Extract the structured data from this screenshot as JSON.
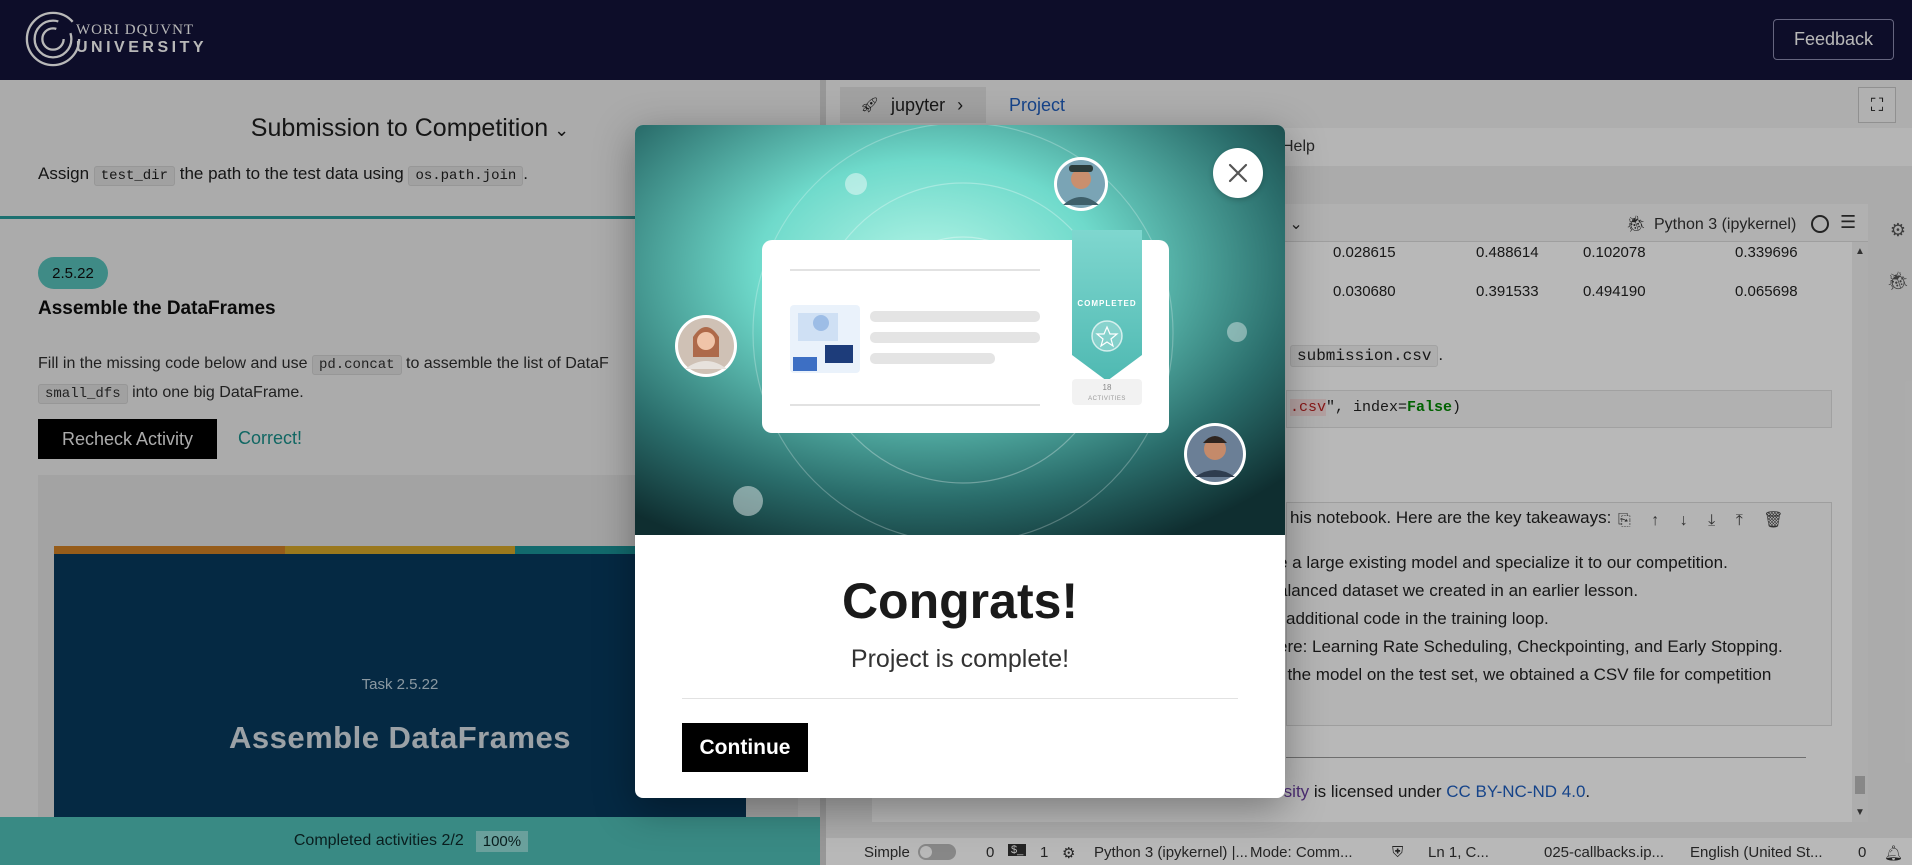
{
  "header": {
    "logo_line1": "WORI DQUVNT",
    "logo_line2": "UNIVERSITY",
    "feedback_label": "Feedback"
  },
  "left_panel": {
    "title": "Submission to Competition",
    "clipped_text_prefix": "Assign",
    "clipped_code_1": "test_dir",
    "clipped_text_mid": "the path to the test data using",
    "clipped_code_2": "os.path.join",
    "clipped_text_suffix": ".",
    "badge": "2.5.22",
    "heading": "Assemble the DataFrames",
    "para_prefix": "Fill in the missing code below and use",
    "para_code_1": "pd.concat",
    "para_mid": "to assemble the list of DataF",
    "para_code_2": "small_dfs",
    "para_suffix": "into one big DataFrame.",
    "recheck_label": "Recheck Activity",
    "correct_label": "Correct!",
    "task_subtitle": "Task 2.5.22",
    "task_title": "Assemble DataFrames",
    "progress_label": "Completed activities 2/2",
    "progress_pct": "100%",
    "progress_value": 1.0
  },
  "jupyter": {
    "tab_label": "jupyter",
    "project_label": "Project",
    "menu_help": "Help",
    "kernel_select_fragment": "n",
    "kernel_name": "Python 3 (ipykernel)",
    "df_rows": [
      [
        "0.028615",
        "0.488614",
        "0.102078",
        "0.339696"
      ],
      [
        "0.030680",
        "0.391533",
        "0.494190",
        "0.065698"
      ]
    ],
    "submission_text": "submission.csv",
    "submission_suffix": ".",
    "code_str_part": ".csv",
    "code_rest": "\", index=",
    "code_false": "False",
    "code_close": ")",
    "takeaways_intro": "his notebook. Here are the key takeaways:",
    "takeaways": [
      "e a large existing model and specialize it to our competition.",
      "alanced dataset we created in an earlier lesson.",
      "additional code in the training loop.",
      "ere: Learning Rate Scheduling, Checkpointing, and Early Stopping.",
      "f the model on the test set, we obtained a CSV file for competition"
    ],
    "license_prefix": "rsity",
    "license_mid": "is licensed under",
    "license_link": "CC BY-NC-ND 4.0",
    "license_suffix": "."
  },
  "statusbar": {
    "mode_simple": "Simple",
    "count_0": "0",
    "count_1": "1",
    "kernel": "Python 3 (ipykernel) |...",
    "mode": "Mode: Comm...",
    "position": "Ln 1, C...",
    "filename": "025-callbacks.ip...",
    "language": "English (United St...",
    "notifications": "0"
  },
  "modal": {
    "card_badge": "COMPLETED",
    "card_activities_count": "18",
    "card_activities_label": "ACTIVITIES",
    "heading": "Congrats!",
    "subtitle": "Project is complete!",
    "continue_label": "Continue"
  },
  "colors": {
    "topbar": "#12123a",
    "teal": "#4fbfb7",
    "task_card": "#083f66",
    "stripe_orange": "#e08a28",
    "stripe_yellow": "#e7b42d",
    "stripe_teal": "#1b9fa3"
  }
}
